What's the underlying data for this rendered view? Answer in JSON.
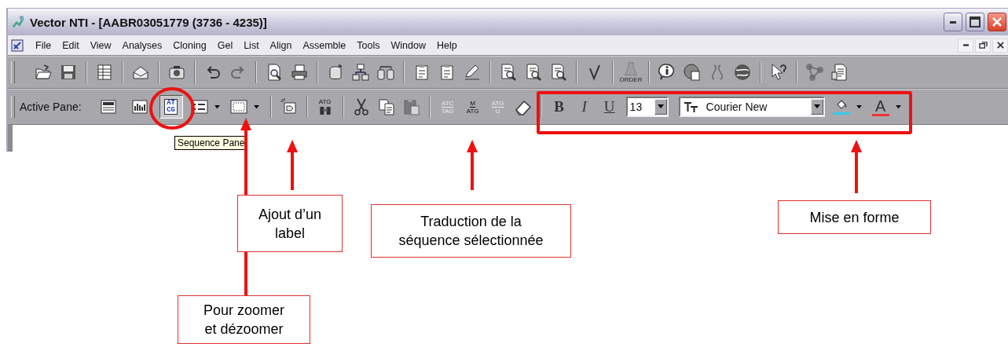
{
  "window": {
    "title": "Vector NTI - [AABR03051779 (3736 - 4235)]"
  },
  "menu": [
    "File",
    "Edit",
    "View",
    "Analyses",
    "Cloning",
    "Gel",
    "List",
    "Align",
    "Assemble",
    "Tools",
    "Window",
    "Help"
  ],
  "toolbar": [
    {
      "kind": "button",
      "disabled": false
    },
    {
      "kind": "button",
      "disabled": false
    },
    {
      "kind": "separator"
    },
    {
      "kind": "button",
      "disabled": false
    },
    {
      "kind": "separator"
    },
    {
      "kind": "button",
      "disabled": false
    },
    {
      "kind": "separator"
    },
    {
      "kind": "button",
      "disabled": false
    },
    {
      "kind": "separator"
    },
    {
      "kind": "button",
      "disabled": false
    },
    {
      "kind": "button",
      "disabled": true
    },
    {
      "kind": "separator"
    },
    {
      "kind": "button",
      "disabled": false
    },
    {
      "kind": "button",
      "disabled": false
    },
    {
      "kind": "separator"
    },
    {
      "kind": "button",
      "disabled": false
    },
    {
      "kind": "button",
      "disabled": false
    },
    {
      "kind": "button",
      "disabled": false
    },
    {
      "kind": "separator"
    },
    {
      "kind": "button",
      "disabled": false
    },
    {
      "kind": "button",
      "disabled": false
    },
    {
      "kind": "button",
      "disabled": false
    },
    {
      "kind": "separator"
    },
    {
      "kind": "button",
      "disabled": false
    },
    {
      "kind": "button",
      "disabled": false
    },
    {
      "kind": "button",
      "disabled": false
    },
    {
      "kind": "separator"
    },
    {
      "kind": "button",
      "disabled": false
    },
    {
      "kind": "separator"
    },
    {
      "kind": "captioned",
      "disabled": true,
      "text": "ORDER"
    },
    {
      "kind": "separator"
    },
    {
      "kind": "button",
      "disabled": false
    },
    {
      "kind": "button",
      "disabled": false
    },
    {
      "kind": "button",
      "disabled": true
    },
    {
      "kind": "button",
      "disabled": false
    },
    {
      "kind": "separator"
    },
    {
      "kind": "button",
      "disabled": false
    },
    {
      "kind": "separator"
    },
    {
      "kind": "button",
      "disabled": true
    },
    {
      "kind": "button",
      "disabled": false
    }
  ],
  "format_toolbar": [
    {
      "kind": "label",
      "text": "Active Pane:"
    },
    {
      "kind": "pane",
      "selected": false
    },
    {
      "kind": "pane",
      "selected": false
    },
    {
      "kind": "pane",
      "selected": true,
      "lines": [
        "AT",
        "CG"
      ]
    },
    {
      "kind": "button",
      "disabled": false
    },
    {
      "kind": "dropdown"
    },
    {
      "kind": "button",
      "disabled": false
    },
    {
      "kind": "dropdown"
    },
    {
      "kind": "separator"
    },
    {
      "kind": "button",
      "disabled": false
    },
    {
      "kind": "separator"
    },
    {
      "kind": "labeled",
      "disabled": false,
      "lines": [
        "ATG"
      ]
    },
    {
      "kind": "separator"
    },
    {
      "kind": "button",
      "disabled": false
    },
    {
      "kind": "button",
      "disabled": false
    },
    {
      "kind": "button",
      "disabled": true
    },
    {
      "kind": "separator"
    },
    {
      "kind": "text-button",
      "disabled": true,
      "lines": [
        "ATC",
        "TAG"
      ]
    },
    {
      "kind": "text-button",
      "disabled": false,
      "lines": [
        "M",
        "ATG"
      ]
    },
    {
      "kind": "text-button",
      "disabled": true,
      "lines": [
        "ATG",
        "U"
      ]
    },
    {
      "kind": "button",
      "disabled": false
    },
    {
      "kind": "separator"
    },
    {
      "kind": "bold",
      "text": "B"
    },
    {
      "kind": "italic",
      "text": "I"
    },
    {
      "kind": "underline",
      "text": "U"
    },
    {
      "kind": "size-field",
      "value": "13"
    },
    {
      "kind": "font-field",
      "value": "Courier New"
    },
    {
      "kind": "color",
      "color": "#33ccee"
    },
    {
      "kind": "dropdown"
    },
    {
      "kind": "color",
      "text": "A",
      "color": "#ee3333"
    },
    {
      "kind": "dropdown"
    }
  ],
  "tooltip": "Sequence Pane",
  "annotations": [
    {
      "text": "Pour zoomer\net dézoomer"
    },
    {
      "text": "Ajout d’un\nlabel"
    },
    {
      "text": "Traduction de la\nséquence sélectionnée"
    },
    {
      "text": "Mise en forme"
    }
  ]
}
